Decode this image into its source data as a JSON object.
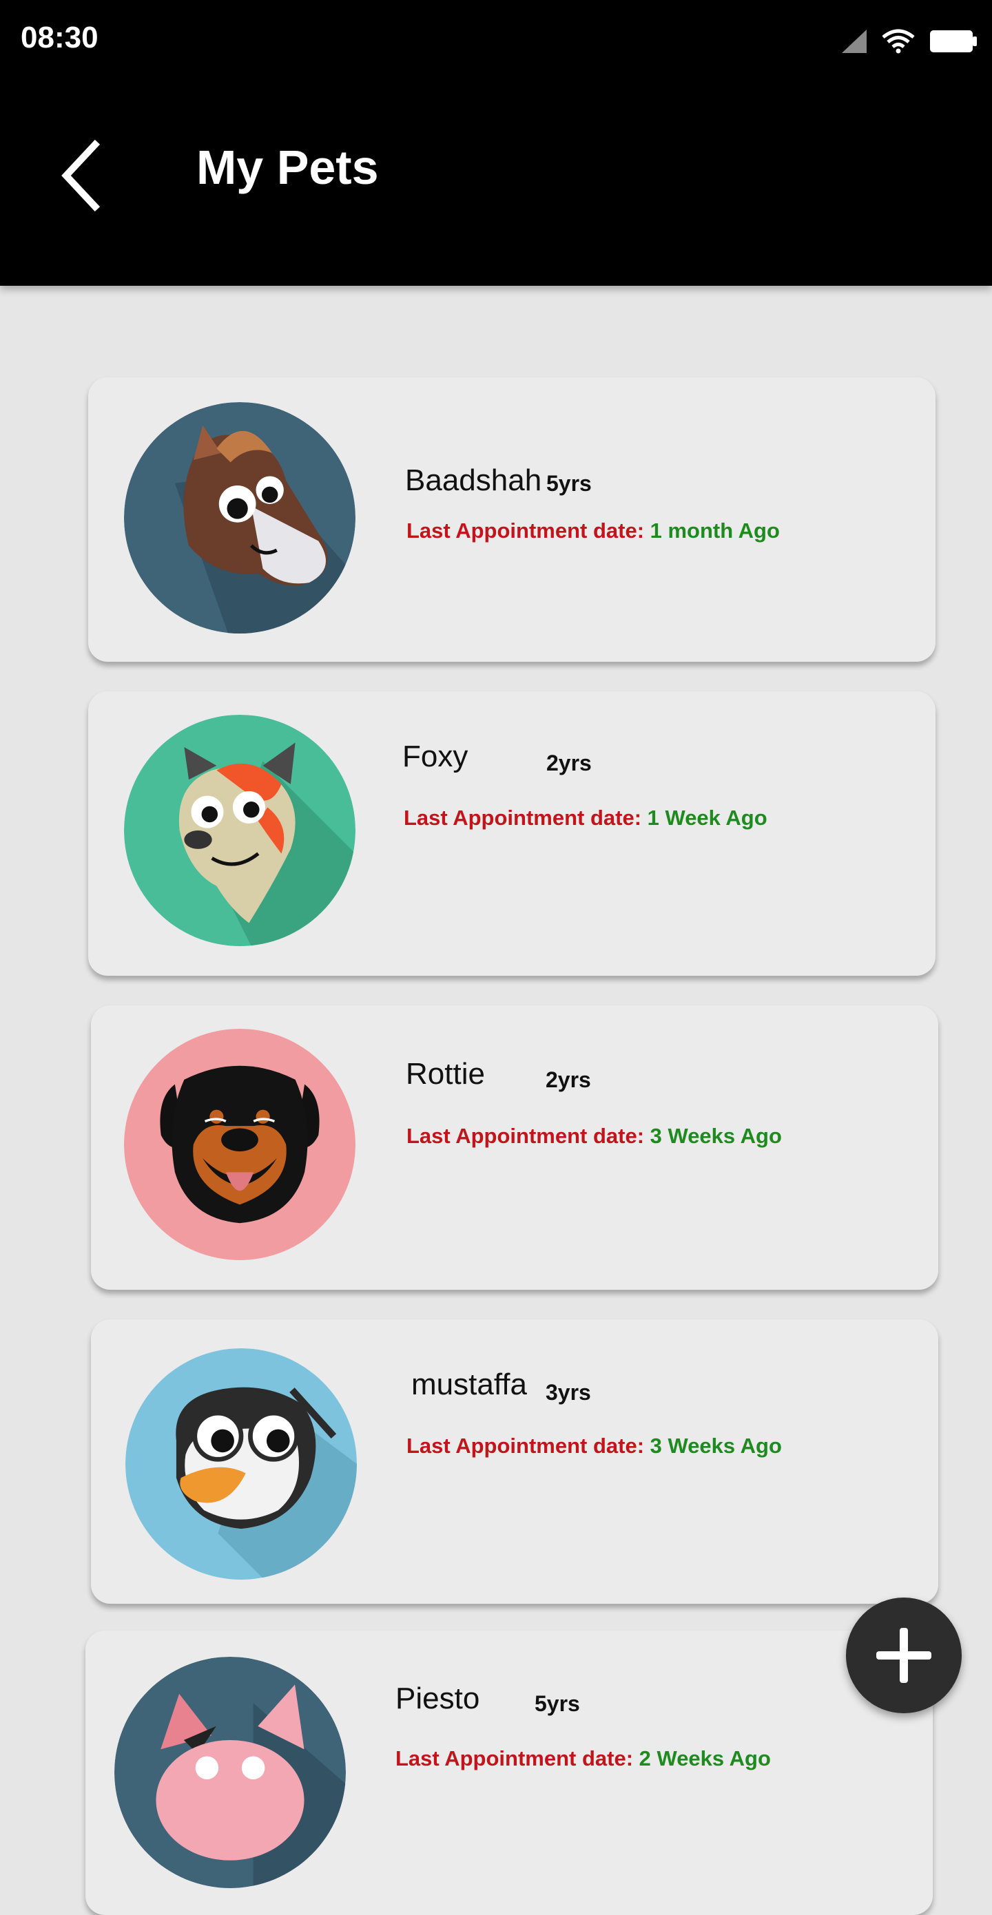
{
  "status_bar": {
    "time": "08:30",
    "icons": [
      "cell-signal-icon",
      "wifi-icon",
      "battery-icon"
    ]
  },
  "app_bar": {
    "title": "My Pets",
    "back_icon": "back-arrow-icon"
  },
  "colors": {
    "label_red": "#c2151b",
    "value_green": "#1f8a1f",
    "fab": "#2d2d2d"
  },
  "pets": [
    {
      "name": "Baadshah",
      "age": "5yrs",
      "appointment_label": "Last Appointment date:",
      "appointment_value": "1 month Ago",
      "avatar": "horse-avatar",
      "avatar_color": "#3f6377"
    },
    {
      "name": "Foxy",
      "age": "2yrs",
      "appointment_label": "Last Appointment date:",
      "appointment_value": "1 Week Ago",
      "avatar": "fox-avatar",
      "avatar_color": "#48bd98"
    },
    {
      "name": "Rottie",
      "age": "2yrs",
      "appointment_label": "Last Appointment date:",
      "appointment_value": "3 Weeks Ago",
      "avatar": "rottweiler-avatar",
      "avatar_color": "#f09ca0"
    },
    {
      "name": "mustaffa",
      "age": "3yrs",
      "appointment_label": "Last Appointment date:",
      "appointment_value": "3 Weeks Ago",
      "avatar": "penguin-avatar",
      "avatar_color": "#7ec3dd"
    },
    {
      "name": "Piesto",
      "age": "5yrs",
      "appointment_label": "Last Appointment date:",
      "appointment_value": "2 Weeks Ago",
      "avatar": "pig-avatar",
      "avatar_color": "#3f6377"
    }
  ],
  "fab": {
    "icon": "plus-icon"
  }
}
